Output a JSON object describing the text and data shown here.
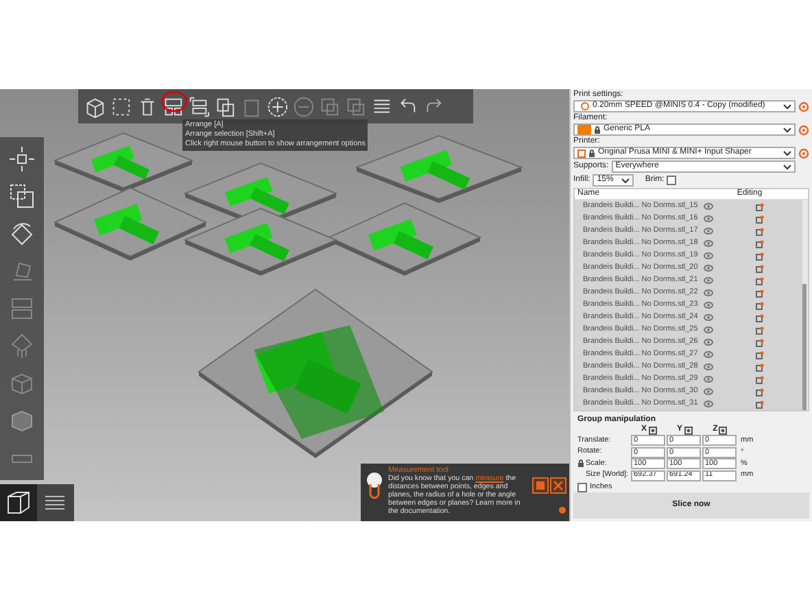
{
  "toolbar": {
    "tooltip": [
      "Arrange [A]",
      "Arrange selection [Shift+A]",
      "Click right mouse button to show arrangement options"
    ]
  },
  "notification": {
    "title": "Measurement tool",
    "text_before": "Did you know that you can ",
    "link": "measure",
    "text_after": " the distances between points, edges and planes, the radius of a hole or the angle between edges or planes? Learn more in the documentation."
  },
  "sidebar": {
    "print_settings": {
      "label": "Print settings:",
      "value": "0.20mm SPEED @MINIS 0.4 - Copy (modified)"
    },
    "filament": {
      "label": "Filament:",
      "value": "Generic PLA"
    },
    "printer": {
      "label": "Printer:",
      "value": "Original Prusa MINI & MINI+ Input Shaper"
    },
    "supports": {
      "label": "Supports:",
      "value": "Everywhere"
    },
    "infill": {
      "label": "Infill:",
      "value": "15%"
    },
    "brim": {
      "label": "Brim:",
      "checked": false
    },
    "object_list": {
      "columns": [
        "Name",
        "Editing"
      ],
      "rows": [
        {
          "name": "Brandeis Buildi... No Dorms.stl_15"
        },
        {
          "name": "Brandeis Buildi... No Dorms.stl_16"
        },
        {
          "name": "Brandeis Buildi... No Dorms.stl_17"
        },
        {
          "name": "Brandeis Buildi... No Dorms.stl_18"
        },
        {
          "name": "Brandeis Buildi... No Dorms.stl_19"
        },
        {
          "name": "Brandeis Buildi... No Dorms.stl_20"
        },
        {
          "name": "Brandeis Buildi... No Dorms.stl_21"
        },
        {
          "name": "Brandeis Buildi... No Dorms.stl_22"
        },
        {
          "name": "Brandeis Buildi... No Dorms.stl_23"
        },
        {
          "name": "Brandeis Buildi... No Dorms.stl_24"
        },
        {
          "name": "Brandeis Buildi... No Dorms.stl_25"
        },
        {
          "name": "Brandeis Buildi... No Dorms.stl_26"
        },
        {
          "name": "Brandeis Buildi... No Dorms.stl_27"
        },
        {
          "name": "Brandeis Buildi... No Dorms.stl_28"
        },
        {
          "name": "Brandeis Buildi... No Dorms.stl_29"
        },
        {
          "name": "Brandeis Buildi... No Dorms.stl_30"
        },
        {
          "name": "Brandeis Buildi... No Dorms.stl_31"
        }
      ]
    },
    "group_manipulation": {
      "title": "Group manipulation",
      "axes": [
        "X",
        "Y",
        "Z"
      ],
      "rows": [
        {
          "label": "Translate:",
          "values": [
            "0",
            "0",
            "0"
          ],
          "unit": "mm"
        },
        {
          "label": "Rotate:",
          "values": [
            "0",
            "0",
            "0"
          ],
          "unit": "°"
        },
        {
          "label": "Scale:",
          "values": [
            "100",
            "100",
            "100"
          ],
          "unit": "%"
        },
        {
          "label": "Size [World]:",
          "values": [
            "692.37",
            "691.24",
            "11"
          ],
          "unit": "mm"
        }
      ],
      "inches": {
        "label": "Inches",
        "checked": false
      }
    },
    "slice_button": "Slice now"
  }
}
